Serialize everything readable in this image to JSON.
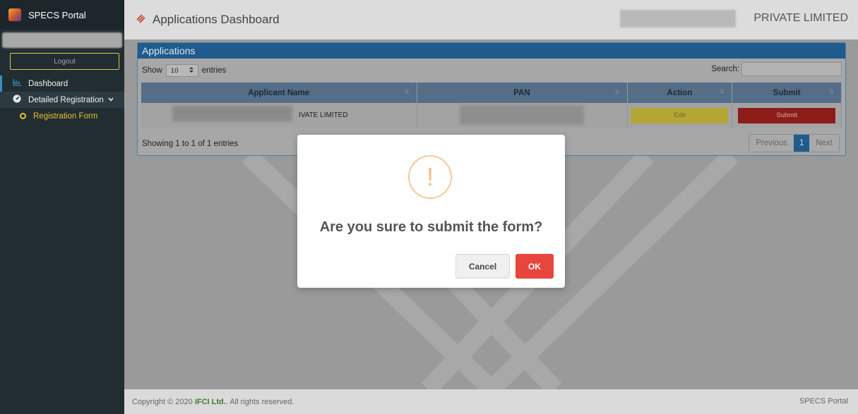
{
  "sidebar": {
    "brand": "SPECS Portal",
    "logout_label": "Logout",
    "items": [
      {
        "label": "Dashboard",
        "icon": "chart-icon"
      },
      {
        "label": "Detailed Registration",
        "icon": "tachometer-icon"
      },
      {
        "label": "Registration Form",
        "icon": "circle-icon"
      }
    ]
  },
  "header": {
    "title": "Applications Dashboard",
    "company": "PRIVATE LIMITED"
  },
  "panel": {
    "title": "Applications",
    "show_label": "Show",
    "entries_value": "10",
    "entries_label": "entries",
    "search_label": "Search:",
    "columns": [
      "Applicant Name",
      "PAN",
      "Action",
      "Submit"
    ],
    "rows": [
      {
        "applicant_name": "IVATE LIMITED",
        "edit_label": "Edit",
        "submit_label": "Submit"
      }
    ],
    "info": "Showing 1 to 1 of 1 entries",
    "pagination": {
      "previous": "Previous",
      "current": "1",
      "next": "Next"
    }
  },
  "modal": {
    "icon_glyph": "!",
    "message": "Are you sure to submit the form?",
    "cancel_label": "Cancel",
    "ok_label": "OK"
  },
  "footer": {
    "copyright_prefix": "Copyright © 2020",
    "company": "IFCI Ltd.",
    "copyright_suffix": ". All rights reserved.",
    "right": "SPECS Portal"
  },
  "colors": {
    "sidebar_bg": "#222d32",
    "panel_header": "#1f5b8c",
    "accent_yellow": "#e7c230",
    "ok_red": "#e8453c",
    "warning_orange": "#f5b886"
  }
}
